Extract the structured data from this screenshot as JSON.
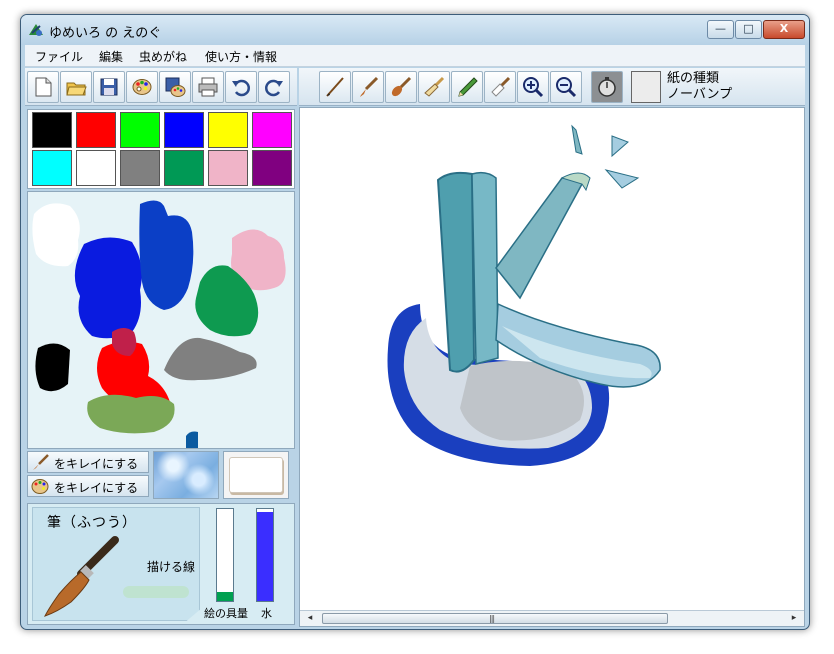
{
  "window": {
    "title": "ゆめいろ の えのぐ",
    "controls": {
      "minimize": "—",
      "maximize": "□",
      "close": "X"
    }
  },
  "menu": [
    "ファイル",
    "編集",
    "虫めがね",
    "使い方・情報"
  ],
  "toolbar_left": [
    "new-document-icon",
    "open-folder-icon",
    "save-disk-icon",
    "palette-icon",
    "save-palette-icon",
    "print-icon",
    "undo-icon",
    "redo-icon"
  ],
  "toolbar_right": [
    "pen-icon",
    "brush-icon",
    "round-brush-icon",
    "flat-brush-icon",
    "pencil-icon",
    "eraser-brush-icon",
    "zoom-in-icon",
    "zoom-out-icon",
    "timer-icon"
  ],
  "paper": {
    "label": "紙の種類",
    "value": "ノーバンプ",
    "color": "#ececec"
  },
  "palette_colors": [
    "#000000",
    "#ff0000",
    "#00ff00",
    "#0000ff",
    "#ffff00",
    "#ff00ff",
    "#00ffff",
    "#ffffff",
    "#808080",
    "#009955",
    "#f0b4c8",
    "#800080"
  ],
  "clean": {
    "brush_label": "をキレイにする",
    "palette_label": "をキレイにする"
  },
  "brush": {
    "name": "筆（ふつう）",
    "line_label": "描ける線",
    "paint_amount_label": "絵の具量",
    "water_label": "水",
    "paint_amount_level": 0.1,
    "water_level": 0.97,
    "paint_color": "#00a050",
    "water_color": "#3a2eff"
  },
  "scrollbar": {
    "left_arrow": "◂",
    "right_arrow": "▸",
    "grip": "|||"
  }
}
